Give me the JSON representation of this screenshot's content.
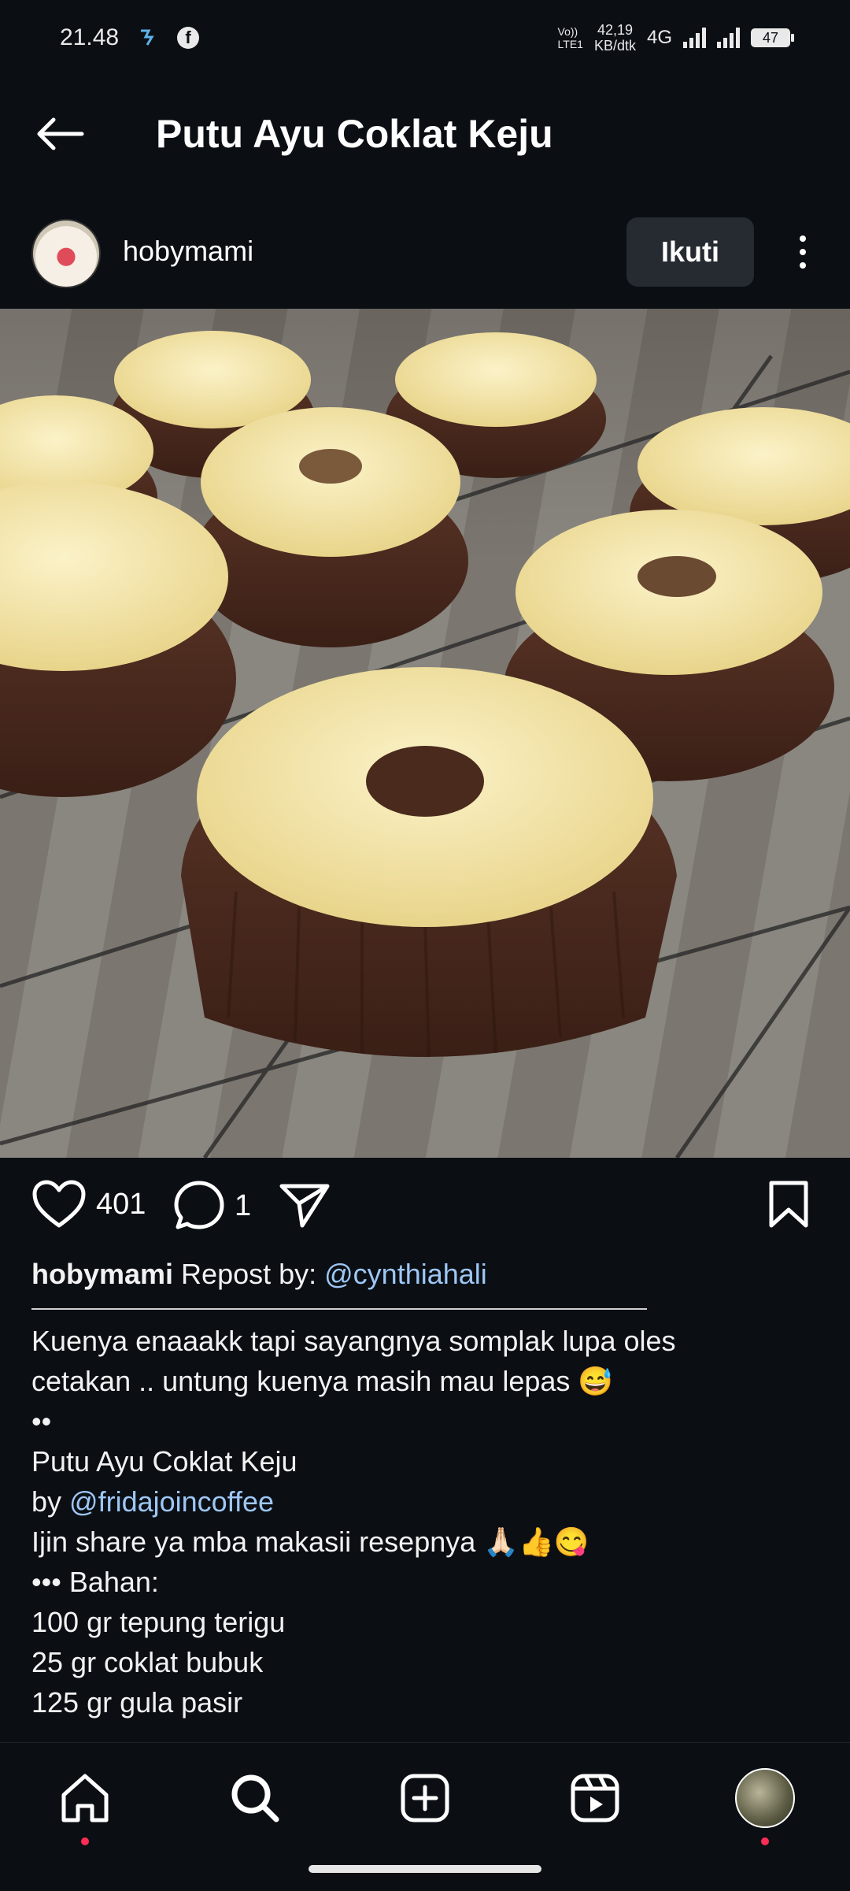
{
  "status_bar": {
    "time": "21.48",
    "volte_top": "Vo))",
    "volte_bottom": "LTE1",
    "speed_value": "42,19",
    "speed_unit": "KB/dtk",
    "network": "4G",
    "battery": "47"
  },
  "header": {
    "title": "Putu Ayu Coklat Keju"
  },
  "post": {
    "username": "hobymami",
    "follow_label": "Ikuti",
    "likes": "401",
    "comments": "1"
  },
  "caption": {
    "username": "hobymami",
    "repost_prefix": " Repost by: ",
    "repost_mention": "@cynthiahali",
    "line1": "Kuenya enaaakk tapi sayangnya somplak lupa oles",
    "line2": "cetakan .. untung kuenya masih mau lepas 😅",
    "line3": "••",
    "line4": "Putu Ayu Coklat Keju",
    "by_prefix": "by ",
    "by_mention": "@fridajoincoffee",
    "line6": "Ijin share ya mba makasii resepnya 🙏🏻👍😋",
    "line7": "••• Bahan:",
    "line8": "100 gr tepung terigu",
    "line9": "25 gr coklat bubuk",
    "line10": "125 gr gula pasir"
  },
  "icons": {
    "back": "arrow-left-icon",
    "like": "heart-icon",
    "comment": "comment-icon",
    "share": "send-icon",
    "save": "bookmark-icon",
    "more": "more-vertical-icon",
    "home": "home-icon",
    "search": "search-icon",
    "create": "plus-square-icon",
    "reels": "reels-icon",
    "profile": "profile-avatar"
  },
  "colors": {
    "background": "#0b0f14",
    "mention": "#9ec7f5",
    "follow_button": "#262a31",
    "notification_dot": "#ff2d55"
  }
}
